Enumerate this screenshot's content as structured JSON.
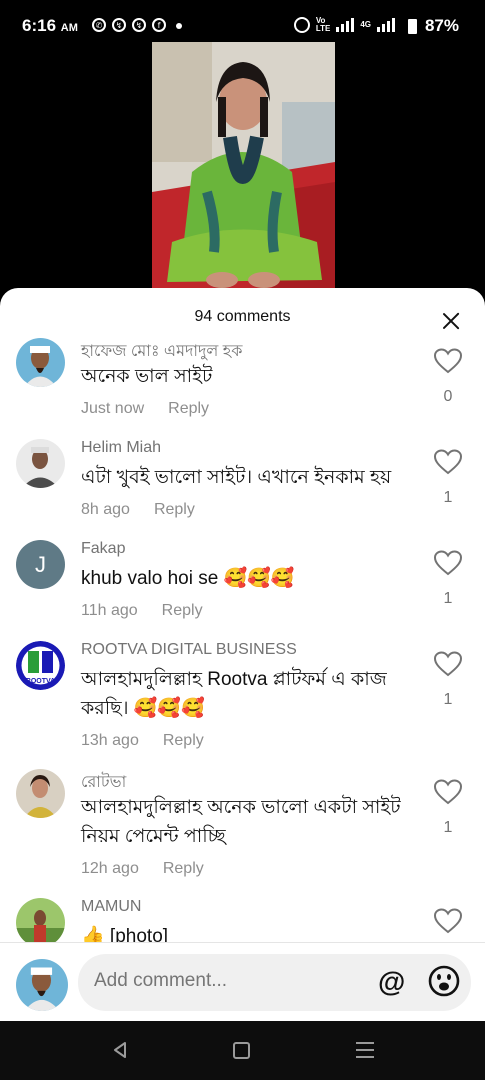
{
  "status_bar": {
    "time": "6:16",
    "ampm": "AM",
    "signal_label_top": "Vo",
    "signal_label_bottom": "LTE",
    "signal2_label": "4G",
    "battery": "87%",
    "icons": [
      "whatsapp-icon",
      "messenger-icon",
      "messenger-icon",
      "facebook-icon",
      "dot-icon",
      "alarm-icon",
      "signal-icon",
      "battery-icon"
    ]
  },
  "sheet": {
    "title": "94 comments"
  },
  "comments": [
    {
      "name": "হাফেজ মোঃ এমদাদুল হক",
      "text": "অনেক ভাল সাইট",
      "time": "Just now",
      "reply": "Reply",
      "likes": "0"
    },
    {
      "name": "Helim Miah",
      "text": "এটা খুবই ভালো সাইট। এখানে ইনকাম হয়",
      "time": "8h ago",
      "reply": "Reply",
      "likes": "1"
    },
    {
      "name": "Fakap",
      "avatar_letter": "J",
      "text": "khub valo hoi se 🥰🥰🥰",
      "time": "11h ago",
      "reply": "Reply",
      "likes": "1"
    },
    {
      "name": "ROOTVA DIGITAL BUSINESS",
      "text": "আলহামদুলিল্লাহ Rootva প্লাটফর্ম এ কাজ করছি। 🥰🥰🥰",
      "time": "13h ago",
      "reply": "Reply",
      "likes": "1"
    },
    {
      "name": "রোটভা",
      "text": "আলহামদুলিল্লাহ অনেক ভালো একটা সাইট নিয়ম পেমেন্ট পাচ্ছি",
      "time": "12h ago",
      "reply": "Reply",
      "likes": "1"
    },
    {
      "name": "MAMUN",
      "text": "👍 [photo]",
      "time": "",
      "reply": "",
      "likes": ""
    }
  ],
  "composer": {
    "placeholder": "Add comment...",
    "at_label": "@"
  },
  "colors": {
    "sheet_bg": "#ffffff",
    "secondary_text": "#737373",
    "accent_blue": "#1a1ab5"
  }
}
